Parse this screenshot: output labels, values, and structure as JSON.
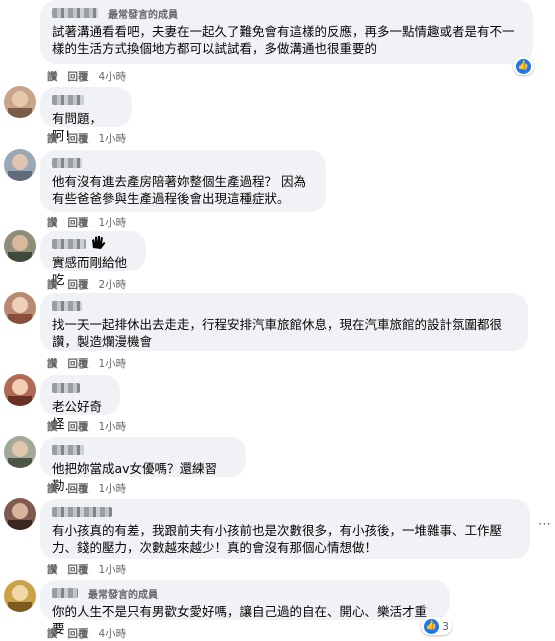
{
  "labels": {
    "like": "讚",
    "reply": "回覆",
    "top_fan": "最常發言的成員"
  },
  "comments": [
    {
      "text": "試著溝通看看吧，夫妻在一起久了難免會有這樣的反應，再多一點情趣或者是有不一樣的生活方式換個地方都可以試試看，多做溝通也很重要的",
      "time": "4小時"
    },
    {
      "text": "有問題，阿！",
      "time": "1小時"
    },
    {
      "text": "他有沒有進去產房陪著妳整個生產過程？ 因為有些爸爸參與生產過程後會出現這種症狀。",
      "time": "1小時"
    },
    {
      "text": "實感而剛給他吃",
      "time": "2小時"
    },
    {
      "text": "找一天一起排休出去走走，行程安排汽車旅館休息，現在汽車旅館的設計氛圍都很讚，製造爛漫機會",
      "time": "1小時"
    },
    {
      "text": "老公好奇怪",
      "time": "1小時"
    },
    {
      "text": "他把妳當成av女優嗎？還練習勒…",
      "time": "1小時"
    },
    {
      "text": "有小孩真的有差，我跟前夫有小孩前也是次數很多，有小孩後，一堆雜事、工作壓力、錢的壓力，次數越來越少！真的會沒有那個心情想做！",
      "time": "1小時"
    },
    {
      "text": "你的人生不是只有男歡女愛好嗎，讓自己過的自在、開心、樂活才重要",
      "time": "4小時",
      "reaction_count": "3"
    }
  ],
  "colors": {
    "bubble": "#f0f2f5",
    "meta": "#65676b",
    "like": "#1877f2"
  },
  "icons": {
    "like": "thumbs-up-icon",
    "wave": "waving-hand-icon",
    "more": "more-options-icon"
  }
}
